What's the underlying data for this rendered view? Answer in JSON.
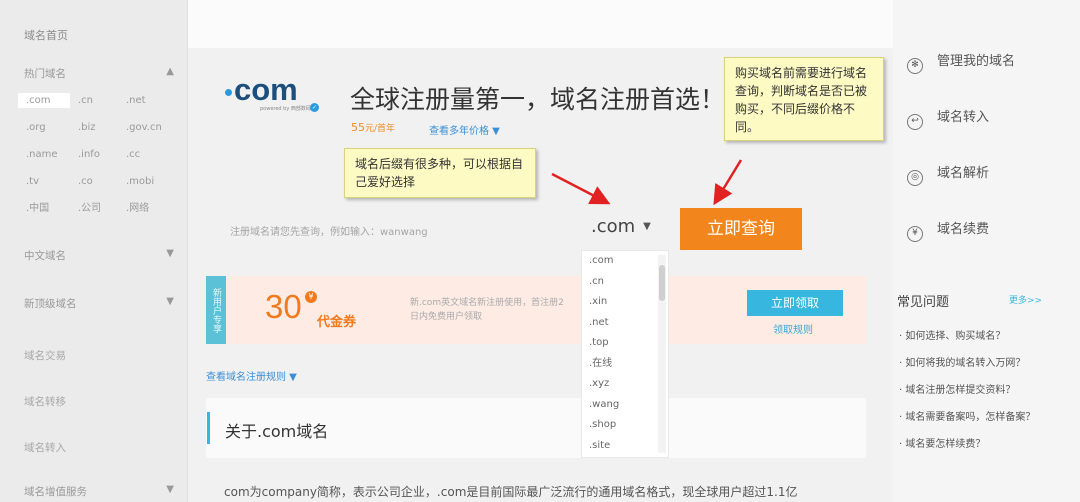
{
  "sidebar": {
    "home": "域名首页",
    "sections": [
      {
        "label": "热门域名",
        "chevron": "▲"
      },
      {
        "label": "中文域名",
        "chevron": "▼"
      },
      {
        "label": "新顶级域名",
        "chevron": "▼"
      }
    ],
    "tlds": [
      ".com",
      ".cn",
      ".net",
      ".org",
      ".biz",
      ".gov.cn",
      ".name",
      ".info",
      ".cc",
      ".tv",
      ".co",
      ".mobi",
      ".中国",
      ".公司",
      ".网络"
    ],
    "items": [
      "域名交易",
      "域名转移",
      "域名转入",
      "域名增值服务"
    ],
    "last_chevron": "▼"
  },
  "header": {
    "logo_text": "com",
    "logo_sub": "powered by 西部数码",
    "logo_badge": "✓",
    "headline": "全球注册量第一，域名注册首选！",
    "price": "55",
    "price_unit": "元/首年",
    "price_link": "查看多年价格 ▼"
  },
  "search": {
    "hint": "注册域名请您先查询，例如输入：wanwang",
    "suffix": ".com",
    "suffix_caret": "▼",
    "button": "立即查询",
    "options": [
      ".com",
      ".cn",
      ".xin",
      ".net",
      ".top",
      ".在线",
      ".xyz",
      ".wang",
      ".shop",
      ".site"
    ]
  },
  "coupon": {
    "tag": "新用户专享",
    "amount": "30",
    "yen": "¥",
    "label": "代金券",
    "desc": "新.com英文域名新注册使用，首注册2日内免费用户领取",
    "claim": "立即领取",
    "rules": "领取规则",
    "reg_rules": "查看域名注册规则 ▼"
  },
  "about": {
    "title": "关于.com域名",
    "text": "com为company简称，表示公司企业，.com是目前国际最广泛流行的通用域名格式，现全球用户超过1.1亿"
  },
  "notes": {
    "note1": "域名后缀有很多种，可以根据自己爱好选择",
    "note2": "购买域名前需要进行域名查询，判断域名是否已被购买，不同后缀价格不同。"
  },
  "right": {
    "links": [
      {
        "icon": "gear-icon",
        "glyph": "✻",
        "label": "管理我的域名"
      },
      {
        "icon": "transfer-in-icon",
        "glyph": "↩",
        "label": "域名转入"
      },
      {
        "icon": "resolve-icon",
        "glyph": "◎",
        "label": "域名解析"
      },
      {
        "icon": "renew-icon",
        "glyph": "¥",
        "label": "域名续费"
      }
    ],
    "faq_title": "常见问题",
    "faq_more": "更多>>",
    "faq": [
      "· 如何选择、购买域名？",
      "· 如何将我的域名转入万网？",
      "· 域名注册怎样提交资料？",
      "· 域名需要备案吗，怎样备案？",
      "· 域名要怎样续费？"
    ]
  },
  "colors": {
    "accent_orange": "#f3851d",
    "accent_cyan": "#37b7e0",
    "note_bg": "#fdfac4",
    "arrow_red": "#e22222"
  }
}
